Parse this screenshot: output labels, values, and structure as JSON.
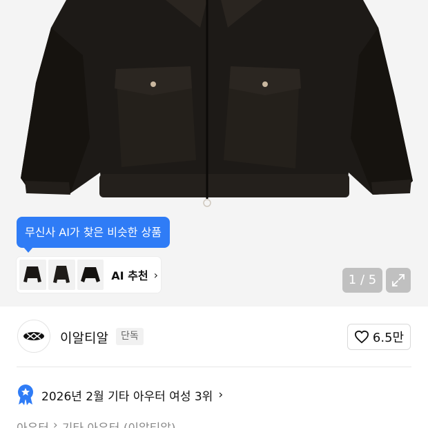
{
  "tooltip": {
    "text": "무신사 AI가 찾은 비슷한 상품"
  },
  "ai_recommendation": {
    "label": "AI 추천",
    "chevron": "›",
    "thumbnails": [
      "jacket-thumb-icon",
      "jacket-thumb-icon",
      "jacket-thumb-icon"
    ]
  },
  "gallery": {
    "counter": "1 / 5",
    "expand_icon": "expand-icon"
  },
  "brand": {
    "name": "이알티알",
    "badge": "단독",
    "logo_icon": "brand-logo-icon"
  },
  "like": {
    "count": "6.5만",
    "icon": "heart-icon"
  },
  "ranking": {
    "text": "2026년 2월 기타 아우터 여성 3위",
    "chevron": "›",
    "icon": "ranking-badge-icon"
  },
  "breadcrumb": {
    "items": [
      "아우터",
      "›",
      "기타 아우터 (이알티알)"
    ]
  },
  "colors": {
    "accent": "#2f7cf6",
    "background": "#f4f4f4",
    "text": "#111111"
  }
}
